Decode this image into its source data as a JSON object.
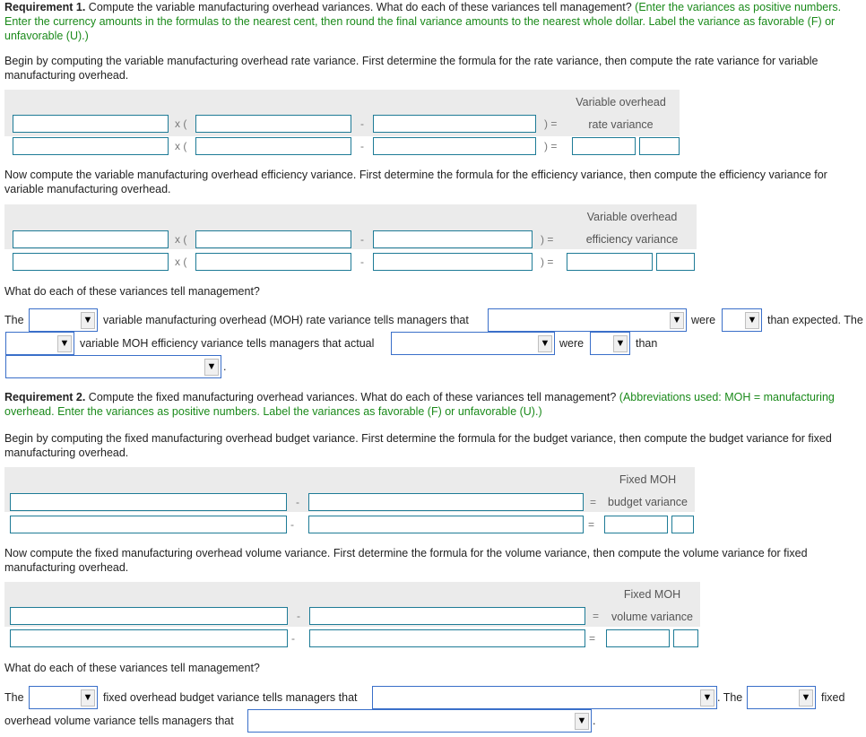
{
  "req1": {
    "label": "Requirement 1.",
    "text": " Compute the variable manufacturing overhead variances. What do each of these variances tell management?",
    "instructions": " (Enter the variances as positive numbers. Enter the currency amounts in the formulas to the nearest cent, then round the final variance amounts to the nearest whole dollar. Label the variance as favorable (F) or unfavorable (U).)",
    "rate_intro": "Begin by computing the variable manufacturing overhead rate variance. First determine the formula for the rate variance, then compute the rate variance for variable manufacturing overhead.",
    "rate_header_1": "Variable overhead",
    "rate_header_2": "rate variance",
    "eff_intro": "Now compute the variable manufacturing overhead efficiency variance. First determine the formula for the efficiency variance, then compute the efficiency variance for variable manufacturing overhead.",
    "eff_header_1": "Variable overhead",
    "eff_header_2": "efficiency variance",
    "question": "What do each of these variances tell management?",
    "s_the": "The",
    "s_rate": "variable manufacturing overhead (MOH) rate variance tells managers that",
    "s_were": "were",
    "s_than_exp": "than expected. The",
    "s_eff": "variable MOH efficiency variance tells managers that actual",
    "s_were2": "were",
    "s_than": "than",
    "s_period": "."
  },
  "req2": {
    "label": "Requirement 2.",
    "text": " Compute the fixed manufacturing overhead variances. What do each of these variances tell management?",
    "instructions": " (Abbreviations used: MOH = manufacturing overhead. Enter the variances as positive numbers. Label the variances as favorable (F) or unfavorable (U).)",
    "budget_intro": "Begin by computing the fixed manufacturing overhead budget variance. First determine the formula for the budget variance, then compute the budget variance for fixed manufacturing overhead.",
    "budget_header_1": "Fixed MOH",
    "budget_header_2": "budget variance",
    "vol_intro": "Now compute the fixed manufacturing overhead volume variance. First determine the formula for the volume variance, then compute the volume variance for fixed manufacturing overhead.",
    "vol_header_1": "Fixed MOH",
    "vol_header_2": "volume variance",
    "question": "What do each of these variances tell management?",
    "s_the": "The",
    "s_budget": "fixed overhead budget variance tells managers that",
    "s_the2": ". The",
    "s_fixed": "fixed",
    "s_volume": "overhead volume variance tells managers that",
    "s_period": "."
  },
  "ops": {
    "times_paren": "x (",
    "minus": "-",
    "close_eq": ")   =",
    "eq": "=",
    "close": ")"
  },
  "icons": {
    "dropdown": "▼"
  }
}
